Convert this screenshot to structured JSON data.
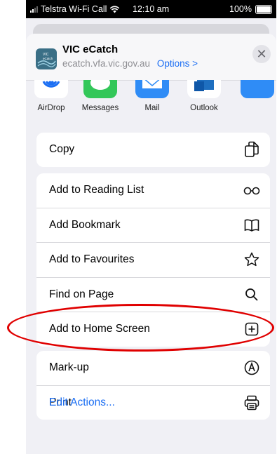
{
  "status_bar": {
    "carrier": "Telstra Wi-Fi Call",
    "time": "12:10 am",
    "battery": "100%"
  },
  "app": {
    "name": "VIC eCatch",
    "url": "ecatch.vfa.vic.gov.au",
    "options_label": "Options >",
    "icon_text_1": "VIC",
    "icon_text_2": "eCatch"
  },
  "close_label": "✕",
  "share_targets": [
    {
      "label": "AirDrop",
      "icon": "airdrop-icon",
      "color": "#ffffff"
    },
    {
      "label": "Messages",
      "icon": "messages-icon",
      "color": "#33c759"
    },
    {
      "label": "Mail",
      "icon": "mail-icon",
      "color": "#2f8cf6"
    },
    {
      "label": "Outlook",
      "icon": "outlook-icon",
      "color": "#ffffff"
    }
  ],
  "groups": [
    [
      {
        "label": "Copy",
        "icon": "copy-icon"
      }
    ],
    [
      {
        "label": "Add to Reading List",
        "icon": "reading-list-icon"
      },
      {
        "label": "Add Bookmark",
        "icon": "bookmark-icon"
      },
      {
        "label": "Add to Favourites",
        "icon": "star-icon"
      },
      {
        "label": "Find on Page",
        "icon": "search-icon"
      },
      {
        "label": "Add to Home Screen",
        "icon": "add-square-icon"
      }
    ],
    [
      {
        "label": "Mark-up",
        "icon": "markup-icon"
      },
      {
        "label": "Print",
        "icon": "print-icon"
      }
    ]
  ],
  "edit_actions": "Edit Actions...",
  "colors": {
    "accent": "#1b6ef3",
    "highlight": "#e00000"
  }
}
